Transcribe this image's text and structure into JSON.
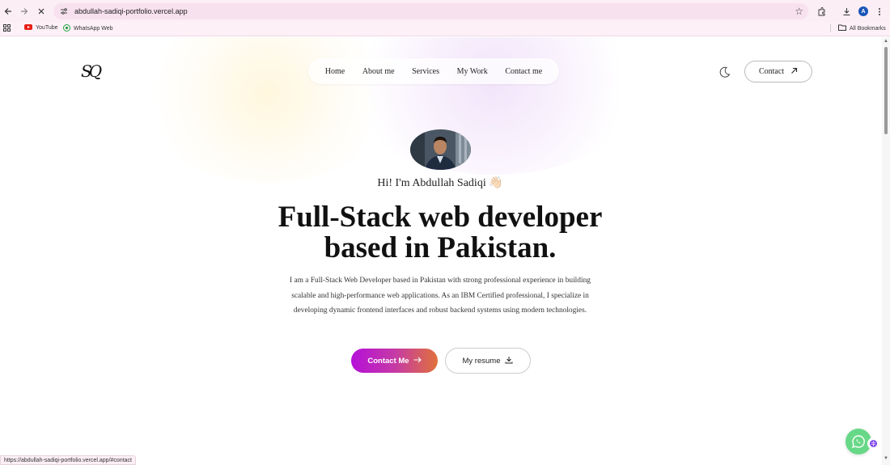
{
  "browser": {
    "url": "abdullah-sadiqi-portfolio.vercel.app",
    "bookmarks": [
      {
        "label": "YouTube",
        "icon": "youtube-icon"
      },
      {
        "label": "WhatsApp Web",
        "icon": "whatsapp-icon"
      }
    ],
    "all_bookmarks_label": "All Bookmarks",
    "profile_initial": "A",
    "status_url": "https://abdullah-sadiqi-portfolio.vercel.app/#contact"
  },
  "site": {
    "logo_text": "SQ",
    "nav": [
      "Home",
      "About me",
      "Services",
      "My Work",
      "Contact me"
    ],
    "contact_button": "Contact",
    "greeting": "Hi! I'm Abdullah Sadiqi 👋🏻",
    "headline_line1": "Full-Stack web developer",
    "headline_line2": "based in Pakistan.",
    "description": "I am a Full-Stack Web Developer based in Pakistan with strong professional experience in building scalable and high-performance web applications. As an IBM Certified professional, I specialize in developing dynamic frontend interfaces and robust backend systems using modern technologies.",
    "primary_cta": "Contact Me",
    "secondary_cta": "My resume"
  },
  "colors": {
    "accent_gradient_start": "#b50fd9",
    "accent_gradient_end": "#e0713b",
    "chrome_bg": "#fbeef5",
    "whatsapp_green": "#67d887"
  }
}
